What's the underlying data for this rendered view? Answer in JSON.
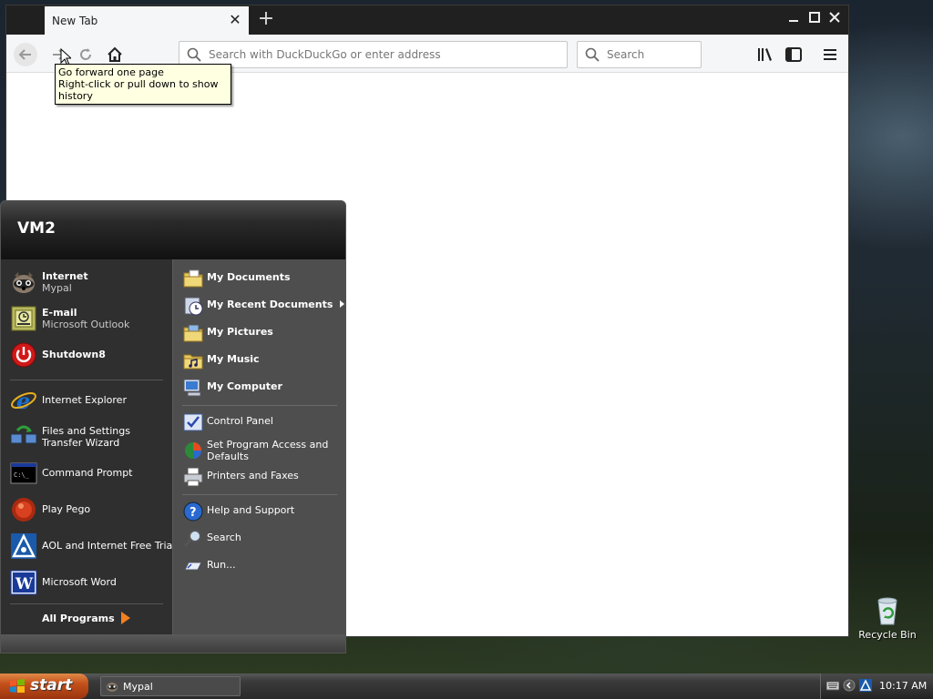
{
  "browser": {
    "tab_title": "New Tab",
    "tab_close": "✕",
    "new_tab": "+",
    "url_placeholder": "Search with DuckDuckGo or enter address",
    "search_placeholder": "Search",
    "tooltip_line1": "Go forward one page",
    "tooltip_line2": "Right-click or pull down to show history"
  },
  "start_menu": {
    "user": "VM2",
    "pinned": [
      {
        "title": "Internet",
        "subtitle": "Mypal",
        "icon": "mypal-raccoon-icon"
      },
      {
        "title": "E-mail",
        "subtitle": "Microsoft Outlook",
        "icon": "outlook-icon"
      },
      {
        "title": "Shutdown8",
        "subtitle": "",
        "icon": "power-icon"
      }
    ],
    "recent": [
      {
        "title": "Internet Explorer",
        "icon": "internet-explorer-icon"
      },
      {
        "title": "Files and Settings Transfer Wizard",
        "icon": "transfer-wizard-icon"
      },
      {
        "title": "Command Prompt",
        "icon": "command-prompt-icon"
      },
      {
        "title": "Play Pego",
        "icon": "pego-icon"
      },
      {
        "title": "AOL and Internet Free Trial!",
        "icon": "aol-icon"
      },
      {
        "title": "Microsoft Word",
        "icon": "word-icon"
      }
    ],
    "all_programs": "All Programs",
    "places": [
      {
        "title": "My Documents",
        "icon": "folder-documents-icon"
      },
      {
        "title": "My Recent Documents",
        "icon": "recent-documents-icon"
      },
      {
        "title": "My Pictures",
        "icon": "folder-pictures-icon"
      },
      {
        "title": "My Music",
        "icon": "folder-music-icon"
      },
      {
        "title": "My Computer",
        "icon": "my-computer-icon"
      }
    ],
    "settings": [
      {
        "title": "Control Panel",
        "icon": "control-panel-icon"
      },
      {
        "title": "Set Program Access and Defaults",
        "icon": "program-defaults-icon"
      },
      {
        "title": "Printers and Faxes",
        "icon": "printer-icon"
      }
    ],
    "help": [
      {
        "title": "Help and Support",
        "icon": "help-icon"
      },
      {
        "title": "Search",
        "icon": "search-icon"
      },
      {
        "title": "Run...",
        "icon": "run-icon"
      }
    ]
  },
  "desktop": {
    "recycle_bin": "Recycle Bin"
  },
  "taskbar": {
    "start_label": "start",
    "task_label": "Mypal",
    "clock": "10:17 AM"
  },
  "colors": {
    "start_button": "#c4501a",
    "tooltip_bg": "#ffffe1",
    "menu_left": "#2f2f2f",
    "menu_right": "#4e4e4e"
  }
}
